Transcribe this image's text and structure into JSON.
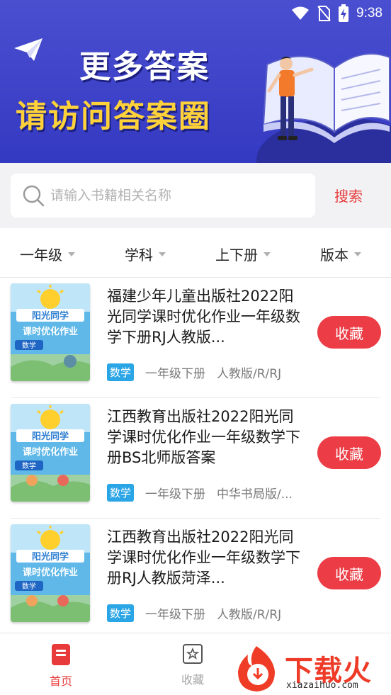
{
  "status_bar": {
    "time": "9:38"
  },
  "banner": {
    "line1": "更多答案",
    "line2": "请访问答案圈"
  },
  "search": {
    "placeholder": "请输入书籍相关名称",
    "button_label": "搜索"
  },
  "filters": [
    {
      "label": "一年级"
    },
    {
      "label": "学科"
    },
    {
      "label": "上下册"
    },
    {
      "label": "版本"
    }
  ],
  "books": [
    {
      "title": "福建少年儿童出版社2022阳光同学课时优化作业一年级数学下册RJ人教版...",
      "subject": "数学",
      "grade": "一年级下册",
      "edition": "人教版/R/RJ",
      "action": "收藏"
    },
    {
      "title": "江西教育出版社2022阳光同学课时优化作业一年级数学下册BS北师版答案",
      "subject": "数学",
      "grade": "一年级下册",
      "edition": "中华书局版/...",
      "action": "收藏"
    },
    {
      "title": "江西教育出版社2022阳光同学课时优化作业一年级数学下册RJ人教版菏泽...",
      "subject": "数学",
      "grade": "一年级下册",
      "edition": "人教版/R/RJ",
      "action": "收藏"
    }
  ],
  "cover": {
    "series": "阳光同学",
    "title": "课时优化作业",
    "subject": "数学"
  },
  "bottom_nav": {
    "home": "首页",
    "favorites": "收藏"
  },
  "watermark": {
    "text": "下载火",
    "url": "xiazaihuo.com"
  },
  "colors": {
    "accent": "#ec3c45",
    "banner": "#3e43c8",
    "tag": "#2aa5e6"
  }
}
